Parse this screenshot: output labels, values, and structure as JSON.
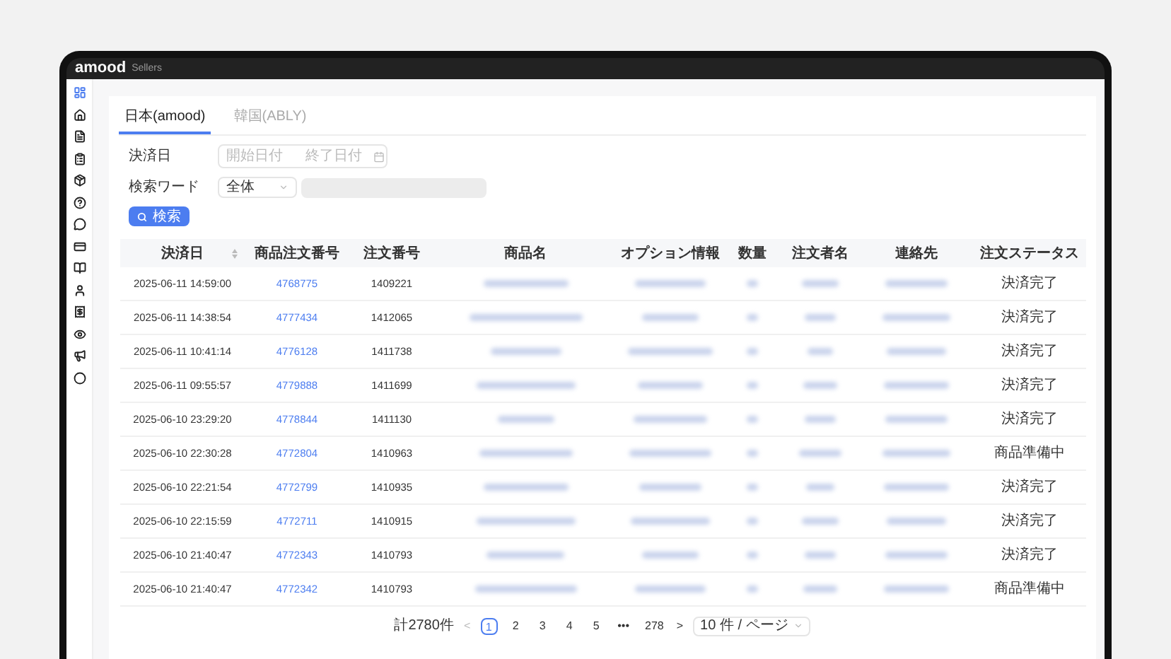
{
  "app": {
    "logo": "amood",
    "subtitle": "Sellers"
  },
  "sidebar": {
    "items": [
      {
        "selected": true
      },
      {
        "selected": false
      },
      {
        "selected": false
      },
      {
        "selected": false
      },
      {
        "selected": false
      },
      {
        "selected": false
      },
      {
        "selected": false
      },
      {
        "selected": false
      },
      {
        "selected": false
      },
      {
        "selected": false
      },
      {
        "selected": false
      },
      {
        "selected": false
      },
      {
        "selected": false
      },
      {
        "selected": false
      }
    ]
  },
  "tabs": [
    {
      "label": "日本(amood)",
      "selected": true
    },
    {
      "label": "韓国(ABLY)",
      "selected": false
    }
  ],
  "filters": {
    "date_label": "決済日",
    "date_start": {
      "placeholder": "開始日付"
    },
    "date_end": {
      "placeholder": "終了日付"
    },
    "keyword_label": "検索ワード",
    "scope_value": "全体",
    "keyword_input": {
      "disabled": true
    },
    "search_button": "検索"
  },
  "table": {
    "columns": [
      "決済日",
      "商品注文番号",
      "注文番号",
      "商品名",
      "オプション情報",
      "数量",
      "注文者名",
      "連絡先",
      "注文ステータス"
    ],
    "rows": [
      {
        "date": "2025-06-11 14:59:00",
        "item_no": "4768775",
        "order_no": "1409221",
        "status": "決済完了"
      },
      {
        "date": "2025-06-11 14:38:54",
        "item_no": "4777434",
        "order_no": "1412065",
        "status": "決済完了"
      },
      {
        "date": "2025-06-11 10:41:14",
        "item_no": "4776128",
        "order_no": "1411738",
        "status": "決済完了"
      },
      {
        "date": "2025-06-11 09:55:57",
        "item_no": "4779888",
        "order_no": "1411699",
        "status": "決済完了"
      },
      {
        "date": "2025-06-10 23:29:20",
        "item_no": "4778844",
        "order_no": "1411130",
        "status": "決済完了"
      },
      {
        "date": "2025-06-10 22:30:28",
        "item_no": "4772804",
        "order_no": "1410963",
        "status": "商品準備中"
      },
      {
        "date": "2025-06-10 22:21:54",
        "item_no": "4772799",
        "order_no": "1410935",
        "status": "決済完了"
      },
      {
        "date": "2025-06-10 22:15:59",
        "item_no": "4772711",
        "order_no": "1410915",
        "status": "決済完了"
      },
      {
        "date": "2025-06-10 21:40:47",
        "item_no": "4772343",
        "order_no": "1410793",
        "status": "決済完了"
      },
      {
        "date": "2025-06-10 21:40:47",
        "item_no": "4772342",
        "order_no": "1410793",
        "status": "商品準備中"
      }
    ]
  },
  "pagination": {
    "total": "計2780件",
    "prev": "<",
    "pages": [
      {
        "label": "1",
        "selected": true
      },
      {
        "label": "2",
        "selected": false
      },
      {
        "label": "3",
        "selected": false
      },
      {
        "label": "4",
        "selected": false
      },
      {
        "label": "5",
        "selected": false
      },
      {
        "label": "•••",
        "selected": false
      },
      {
        "label": "278",
        "selected": false
      }
    ],
    "next": ">",
    "page_size": "10 件 / ページ"
  }
}
